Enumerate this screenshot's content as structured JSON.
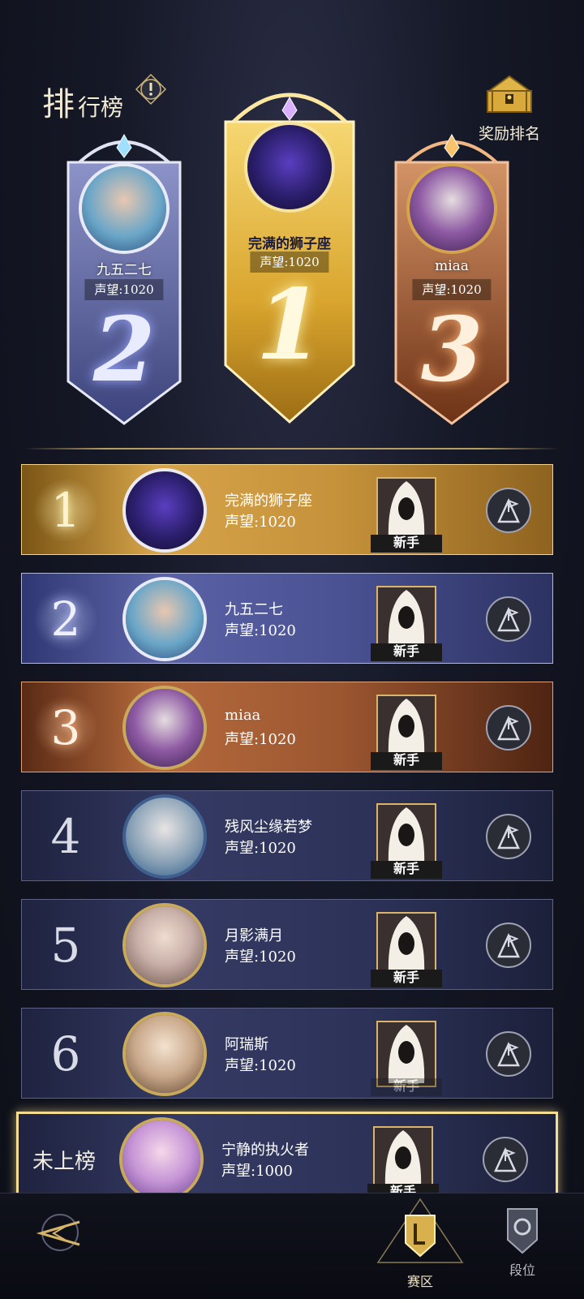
{
  "header": {
    "title_big": "排",
    "title_rest": "行榜",
    "reward_label": "奖励排名"
  },
  "podium": [
    {
      "place": "2",
      "name": "九五二七",
      "reputation": "声望:1020"
    },
    {
      "place": "1",
      "name": "完满的狮子座",
      "reputation": "声望:1020"
    },
    {
      "place": "3",
      "name": "miaa",
      "reputation": "声望:1020"
    }
  ],
  "list": [
    {
      "rank": "1",
      "name": "完满的狮子座",
      "reputation": "声望:1020",
      "badge": "新手",
      "style": "gold"
    },
    {
      "rank": "2",
      "name": "九五二七",
      "reputation": "声望:1020",
      "badge": "新手",
      "style": "silver"
    },
    {
      "rank": "3",
      "name": "miaa",
      "reputation": "声望:1020",
      "badge": "新手",
      "style": "bronze"
    },
    {
      "rank": "4",
      "name": "残风尘缘若梦",
      "reputation": "声望:1020",
      "badge": "新手",
      "style": "plain"
    },
    {
      "rank": "5",
      "name": "月影满月",
      "reputation": "声望:1020",
      "badge": "新手",
      "style": "plain"
    },
    {
      "rank": "6",
      "name": "阿瑞斯",
      "reputation": "声望:1020",
      "badge": "新手",
      "style": "plain"
    }
  ],
  "me": {
    "rank": "未上榜",
    "name": "宁静的执火者",
    "reputation": "声望:1000",
    "badge": "新手"
  },
  "nav": {
    "zone_label": "赛区",
    "tier_label": "段位"
  }
}
